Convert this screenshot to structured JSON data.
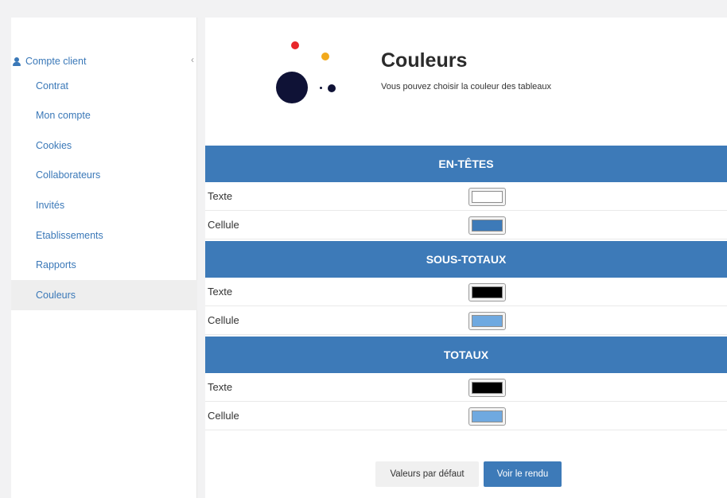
{
  "sidebar": {
    "section_label": "Compte client",
    "collapse_glyph": "‹",
    "items": [
      {
        "label": "Contrat"
      },
      {
        "label": "Mon compte"
      },
      {
        "label": "Cookies"
      },
      {
        "label": "Collaborateurs"
      },
      {
        "label": "Invités"
      },
      {
        "label": "Etablissements"
      },
      {
        "label": "Rapports"
      },
      {
        "label": "Couleurs",
        "active": true
      }
    ]
  },
  "main": {
    "title": "Couleurs",
    "subtitle": "Vous pouvez choisir la couleur des tableaux",
    "sections": [
      {
        "heading": "EN-TÊTES",
        "rows": [
          {
            "label": "Texte",
            "color": "#ffffff"
          },
          {
            "label": "Cellule",
            "color": "#3d7ab8"
          }
        ]
      },
      {
        "heading": "SOUS-TOTAUX",
        "rows": [
          {
            "label": "Texte",
            "color": "#000000"
          },
          {
            "label": "Cellule",
            "color": "#6fa9e0"
          }
        ]
      },
      {
        "heading": "TOTAUX",
        "rows": [
          {
            "label": "Texte",
            "color": "#000000"
          },
          {
            "label": "Cellule",
            "color": "#6fa9e0"
          }
        ]
      }
    ],
    "buttons": {
      "reset_label": "Valeurs par défaut",
      "preview_label": "Voir le rendu"
    }
  },
  "colors": {
    "accent": "#3d7ab8",
    "link": "#3a78b8",
    "logo_red": "#e8262a",
    "logo_yellow": "#f2a91c",
    "logo_navy": "#0f1236"
  },
  "icons": {
    "section_icon": "user-icon",
    "collapse_icon": "chevron-left-icon"
  }
}
